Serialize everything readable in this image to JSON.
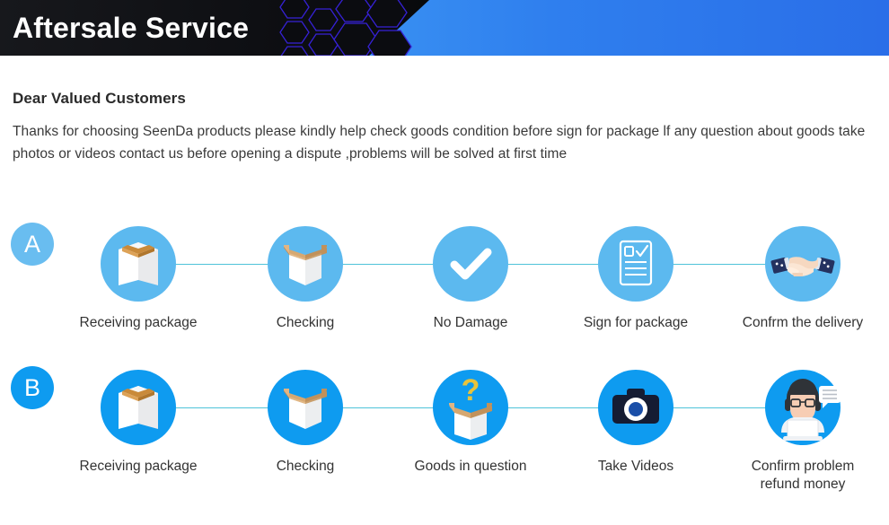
{
  "banner": {
    "title": "Aftersale Service",
    "dark_color": "#0e0f13",
    "blue_start": "#52b9fb",
    "blue_end": "#2a6ee8",
    "hexagon_stroke": "#3621d6"
  },
  "intro": {
    "heading": "Dear Valued Customers",
    "body": "Thanks for choosing SeenDa products please kindly help check goods condition before sign for package lf any question about goods take photos or videos contact us before opening a dispute ,problems will be solved at first time"
  },
  "flow": {
    "connector_color": "#4fc3d9",
    "rows": [
      {
        "badge": "A",
        "badge_color": "#69bdf0",
        "circle_color": "#5cb9ef",
        "steps": [
          {
            "icon": "closed-box-icon",
            "label": "Receiving package"
          },
          {
            "icon": "open-box-icon",
            "label": "Checking"
          },
          {
            "icon": "check-mark-icon",
            "label": "No Damage"
          },
          {
            "icon": "signed-document-icon",
            "label": "Sign for package"
          },
          {
            "icon": "handshake-icon",
            "label": "Confrm the delivery"
          }
        ]
      },
      {
        "badge": "B",
        "badge_color": "#0e9bf0",
        "circle_color": "#0e9bf0",
        "steps": [
          {
            "icon": "closed-box-icon",
            "label": "Receiving package"
          },
          {
            "icon": "open-box-icon",
            "label": "Checking"
          },
          {
            "icon": "question-box-icon",
            "label": "Goods in question"
          },
          {
            "icon": "camera-icon",
            "label": "Take Videos"
          },
          {
            "icon": "support-agent-icon",
            "label": "Confirm problem\nrefund money"
          }
        ]
      }
    ]
  }
}
